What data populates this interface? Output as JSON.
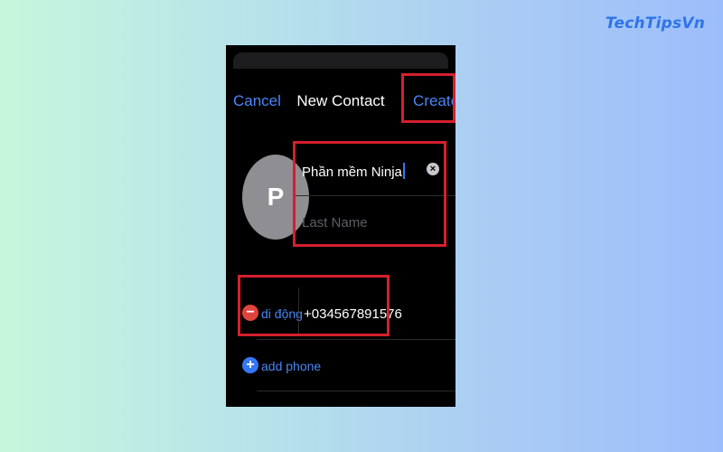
{
  "brand": {
    "watermark": "TechTipsVn"
  },
  "nav": {
    "cancel_label": "Cancel",
    "title": "New Contact",
    "create_label": "Create"
  },
  "contact": {
    "avatar_initial": "P",
    "first_name": "Phần mềm Ninja",
    "last_name_placeholder": "Last Name"
  },
  "phone": {
    "label": "di động",
    "number": "+034567891576",
    "add_label": "add phone"
  },
  "icons": {
    "clear": "clear-icon",
    "remove": "minus-icon",
    "add": "plus-icon"
  },
  "colors": {
    "accent": "#4a86f7",
    "highlight": "#d4202c",
    "remove": "#e0443e",
    "add": "#3478f6"
  }
}
